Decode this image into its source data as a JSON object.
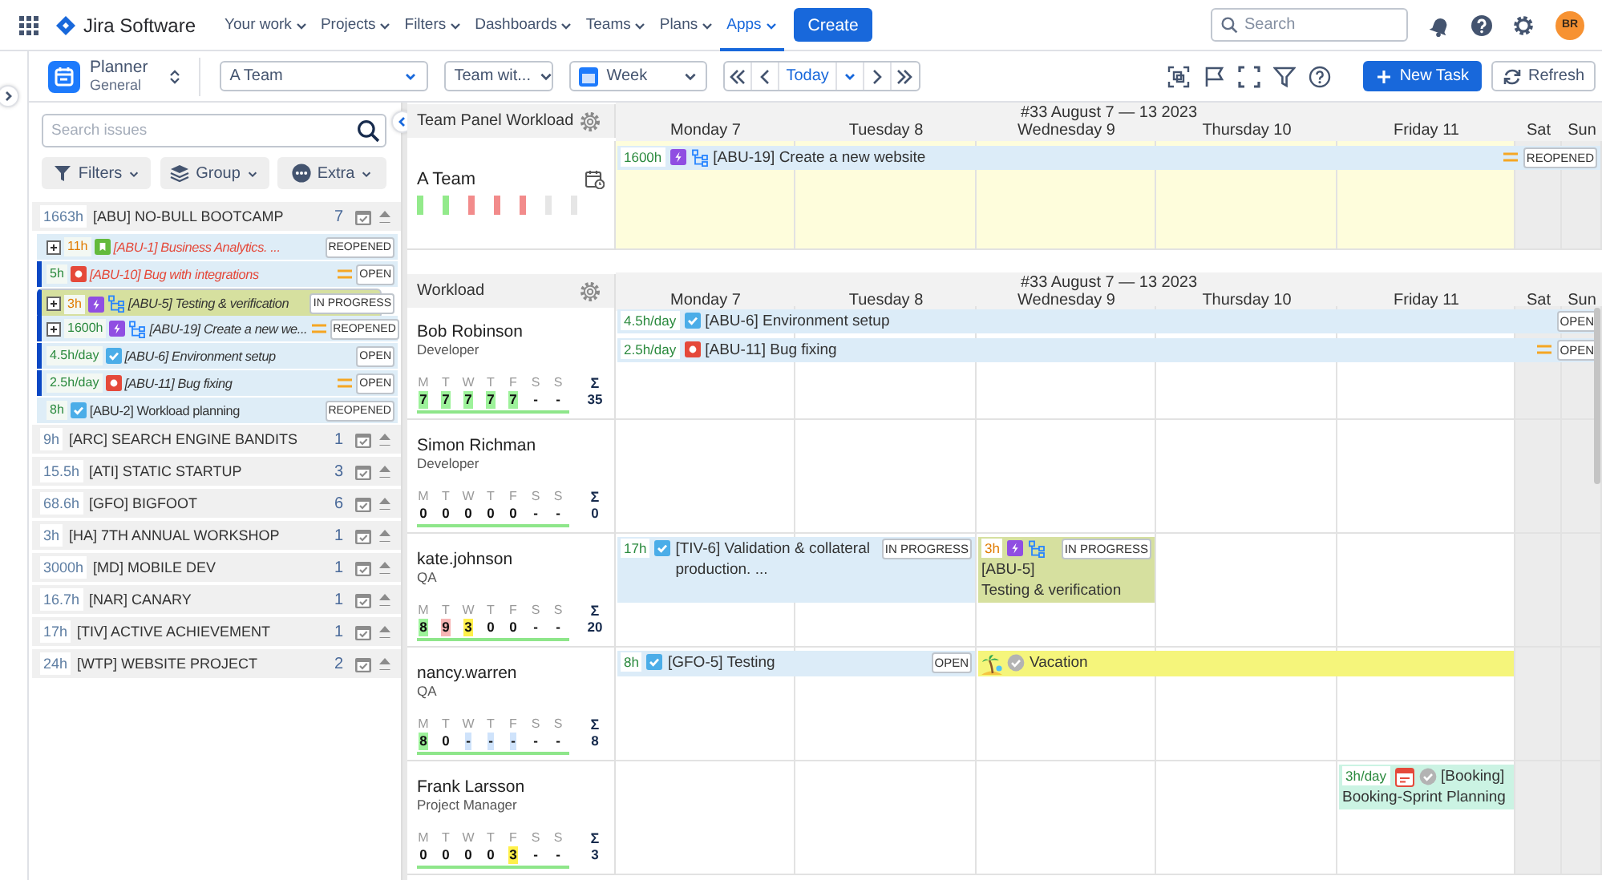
{
  "topnav": {
    "logo": "Jira Software",
    "items": [
      {
        "label": "Your work",
        "selected": false
      },
      {
        "label": "Projects",
        "selected": false
      },
      {
        "label": "Filters",
        "selected": false
      },
      {
        "label": "Dashboards",
        "selected": false
      },
      {
        "label": "Teams",
        "selected": false
      },
      {
        "label": "Plans",
        "selected": false
      },
      {
        "label": "Apps",
        "selected": true
      }
    ],
    "create": "Create",
    "search": {
      "placeholder": "Search"
    },
    "avatar": "BR"
  },
  "toolbar": {
    "app": {
      "title": "Planner",
      "subtitle": "General"
    },
    "selects": [
      {
        "kind": "team",
        "value": "A Team"
      },
      {
        "kind": "view",
        "value": "Team wit..."
      },
      {
        "kind": "period",
        "value": "Week"
      }
    ],
    "today": "Today",
    "new_task": "New Task",
    "refresh": "Refresh"
  },
  "issues_panel": {
    "search": {
      "placeholder": "Search issues"
    },
    "buttons": [
      {
        "kind": "filters",
        "label": "Filters"
      },
      {
        "kind": "group",
        "label": "Group"
      },
      {
        "kind": "extra",
        "label": "Extra"
      }
    ],
    "projects": [
      {
        "hours": "1663h",
        "name": "[ABU] NO-BULL BOOTCAMP",
        "count": "7",
        "issues": [
          {
            "expandable": true,
            "hours": "11h",
            "warning": true,
            "kind": "story",
            "subtasks": false,
            "label": {
              "kind": "overdue",
              "text": "[ABU-1] Business Analytics. ..."
            },
            "prioritized": false,
            "status": "REOPENED",
            "marked": false,
            "selected": false
          },
          {
            "expandable": false,
            "hours": "5h",
            "warning": false,
            "kind": "bug",
            "subtasks": false,
            "label": {
              "kind": "overdue",
              "text": "[ABU-10] Bug with integrations"
            },
            "prioritized": true,
            "status": "OPEN",
            "marked": true,
            "selected": false
          },
          {
            "expandable": true,
            "hours": "3h",
            "warning": true,
            "kind": "epic",
            "subtasks": true,
            "label": {
              "kind": "scheduled",
              "text": "[ABU-5] Testing & verification"
            },
            "prioritized": false,
            "status": "IN PROGRESS",
            "marked": true,
            "selected": true
          },
          {
            "expandable": true,
            "hours": "1600h",
            "warning": false,
            "kind": "epic",
            "subtasks": true,
            "label": {
              "kind": "scheduled",
              "text": "[ABU-19] Create a new we..."
            },
            "prioritized": true,
            "status": "REOPENED",
            "marked": true,
            "selected": false
          },
          {
            "expandable": false,
            "hours": "4.5h/day",
            "warning": false,
            "kind": "task",
            "subtasks": false,
            "label": {
              "kind": "scheduled",
              "text": "[ABU-6] Environment setup"
            },
            "prioritized": false,
            "status": "OPEN",
            "marked": true,
            "selected": false
          },
          {
            "expandable": false,
            "hours": "2.5h/day",
            "warning": false,
            "kind": "bug",
            "subtasks": false,
            "label": {
              "kind": "scheduled",
              "text": "[ABU-11] Bug fixing"
            },
            "prioritized": true,
            "status": "OPEN",
            "marked": true,
            "selected": false
          },
          {
            "expandable": false,
            "hours": "8h",
            "warning": false,
            "kind": "task",
            "subtasks": false,
            "label": {
              "kind": "plain",
              "text": "[ABU-2] Workload planning"
            },
            "prioritized": false,
            "status": "REOPENED",
            "marked": false,
            "selected": false
          }
        ]
      },
      {
        "hours": "9h",
        "name": "[ARC] SEARCH ENGINE BANDITS",
        "count": "1"
      },
      {
        "hours": "15.5h",
        "name": "[ATI] STATIC STARTUP",
        "count": "3"
      },
      {
        "hours": "68.6h",
        "name": "[GFO] BIGFOOT",
        "count": "6"
      },
      {
        "hours": "3h",
        "name": "[HA] 7TH ANNUAL WORKSHOP",
        "count": "1"
      },
      {
        "hours": "3000h",
        "name": "[MD] MOBILE DEV",
        "count": "1"
      },
      {
        "hours": "16.7h",
        "name": "[NAR] CANARY",
        "count": "1"
      },
      {
        "hours": "17h",
        "name": "[TIV] ACTIVE ACHIEVEMENT",
        "count": "1"
      },
      {
        "hours": "24h",
        "name": "[WTP] WEBSITE PROJECT",
        "count": "2"
      }
    ]
  },
  "team_panel": {
    "title": "Team Panel Workload",
    "team": "A Team",
    "day_loads": [
      {
        "color": "#93ea8b"
      },
      {
        "color": "#93ea8b"
      },
      {
        "color": "#f28b8b"
      },
      {
        "color": "#f28b8b"
      },
      {
        "color": "#f28b8b"
      },
      {
        "color": "#e6e6e6"
      },
      {
        "color": "#e6e6e6"
      }
    ],
    "week": "#33 August 7 — 13 2023",
    "days": [
      {
        "label": "Monday 7",
        "weekend": false
      },
      {
        "label": "Tuesday 8",
        "weekend": false
      },
      {
        "label": "Wednesday 9",
        "weekend": false
      },
      {
        "label": "Thursday 10",
        "weekend": false
      },
      {
        "label": "Friday 11",
        "weekend": false
      },
      {
        "label": "Sat",
        "weekend": true
      },
      {
        "label": "Sun",
        "weekend": true
      }
    ],
    "lanes": [
      {
        "slots": [
          {
            "kind": "epic",
            "hours": "1600h",
            "warning": false,
            "subtasks": true,
            "title": "[ABU-19] Create a new website",
            "prioritized": true,
            "status": "REOPENED",
            "color": "#dcecf8"
          },
          {
            "kind": "continued"
          },
          {
            "kind": "continued"
          },
          {
            "kind": "continued"
          },
          {
            "kind": "continued"
          },
          {
            "kind": "continued"
          },
          {
            "kind": "continued"
          }
        ]
      }
    ]
  },
  "workload": {
    "title": "Workload",
    "week": "#33 August 7 — 13 2023",
    "days": [
      {
        "label": "Monday 7",
        "weekend": false
      },
      {
        "label": "Tuesday 8",
        "weekend": false
      },
      {
        "label": "Wednesday 9",
        "weekend": false
      },
      {
        "label": "Thursday 10",
        "weekend": false
      },
      {
        "label": "Friday 11",
        "weekend": false
      },
      {
        "label": "Sat",
        "weekend": true
      },
      {
        "label": "Sun",
        "weekend": true
      }
    ],
    "people": [
      {
        "name": "Bob Robinson",
        "role": "Developer",
        "sum_label": "Σ",
        "total": "35",
        "days": [
          {
            "letter": "M",
            "value": "7",
            "color": "#9df29a"
          },
          {
            "letter": "T",
            "value": "7",
            "color": "#9df29a"
          },
          {
            "letter": "W",
            "value": "7",
            "color": "#9df29a"
          },
          {
            "letter": "T",
            "value": "7",
            "color": "#9df29a"
          },
          {
            "letter": "F",
            "value": "7",
            "color": "#9df29a"
          },
          {
            "letter": "S",
            "value": "-"
          },
          {
            "letter": "S",
            "value": "-"
          }
        ],
        "lanes": [
          {
            "slots": [
              {
                "kind": "task",
                "hours": "4.5h/day",
                "warning": false,
                "subtasks": false,
                "title": "[ABU-6] Environment setup",
                "prioritized": false,
                "status": "OPEN",
                "color": "#dcecf8"
              },
              {
                "kind": "continued"
              },
              {
                "kind": "continued"
              },
              {
                "kind": "continued"
              },
              {
                "kind": "continued"
              },
              {
                "kind": "continued"
              },
              {
                "kind": "continued"
              }
            ]
          },
          {
            "slots": [
              {
                "kind": "bug",
                "hours": "2.5h/day",
                "warning": false,
                "subtasks": false,
                "title": "[ABU-11] Bug fixing",
                "prioritized": true,
                "status": "OPEN",
                "color": "#dcecf8"
              },
              {
                "kind": "continued"
              },
              {
                "kind": "continued"
              },
              {
                "kind": "continued"
              },
              {
                "kind": "continued"
              },
              {
                "kind": "continued"
              },
              {
                "kind": "continued"
              }
            ]
          }
        ]
      },
      {
        "name": "Simon Richman",
        "role": "Developer",
        "sum_label": "Σ",
        "total": "0",
        "days": [
          {
            "letter": "M",
            "value": "0"
          },
          {
            "letter": "T",
            "value": "0"
          },
          {
            "letter": "W",
            "value": "0"
          },
          {
            "letter": "T",
            "value": "0"
          },
          {
            "letter": "F",
            "value": "0"
          },
          {
            "letter": "S",
            "value": "-"
          },
          {
            "letter": "S",
            "value": "-"
          }
        ]
      },
      {
        "name": "kate.johnson",
        "role": "QA",
        "sum_label": "Σ",
        "total": "20",
        "days": [
          {
            "letter": "M",
            "value": "8",
            "color": "#9df29a"
          },
          {
            "letter": "T",
            "value": "9",
            "color": "#f7b5b5"
          },
          {
            "letter": "W",
            "value": "3",
            "color": "#fff04a"
          },
          {
            "letter": "T",
            "value": "0"
          },
          {
            "letter": "F",
            "value": "0"
          },
          {
            "letter": "S",
            "value": "-"
          },
          {
            "letter": "S",
            "value": "-"
          }
        ],
        "lanes": [
          {
            "slots": [
              {
                "kind": "task",
                "hours": "17h",
                "warning": false,
                "subtasks": false,
                "title": "[TIV-6] Validation & collateral production. ...",
                "prioritized": false,
                "status": "IN PROGRESS",
                "color": "#dcecf8"
              },
              {
                "kind": "continued"
              },
              {
                "kind": "epic",
                "hours": "3h",
                "warning": true,
                "subtasks": true,
                "title": "[ABU-5]",
                "subtitle": "Testing & verification",
                "prioritized": false,
                "status": "IN PROGRESS",
                "color": "#d6e09f"
              },
              {
                "kind": "empty"
              },
              {
                "kind": "empty"
              },
              {
                "kind": "empty"
              },
              {
                "kind": "empty"
              }
            ]
          }
        ]
      },
      {
        "name": "nancy.warren",
        "role": "QA",
        "sum_label": "Σ",
        "total": "8",
        "days": [
          {
            "letter": "M",
            "value": "8",
            "color": "#9df29a"
          },
          {
            "letter": "T",
            "value": "0"
          },
          {
            "letter": "W",
            "value": "-",
            "color": "#cfe3fb"
          },
          {
            "letter": "T",
            "value": "-",
            "color": "#cfe3fb"
          },
          {
            "letter": "F",
            "value": "-",
            "color": "#cfe3fb"
          },
          {
            "letter": "S",
            "value": "-"
          },
          {
            "letter": "S",
            "value": "-"
          }
        ],
        "lanes": [
          {
            "slots": [
              {
                "kind": "task",
                "hours": "8h",
                "warning": false,
                "subtasks": false,
                "title": "[GFO-5] Testing",
                "prioritized": false,
                "status": "OPEN",
                "color": "#dcecf8"
              },
              {
                "kind": "continued"
              },
              {
                "kind": "absence",
                "title": "Vacation",
                "color": "#f5f57b"
              },
              {
                "kind": "continued"
              },
              {
                "kind": "continued"
              },
              {
                "kind": "empty"
              },
              {
                "kind": "empty"
              }
            ]
          }
        ]
      },
      {
        "name": "Frank Larsson",
        "role": "Project Manager",
        "sum_label": "Σ",
        "total": "3",
        "days": [
          {
            "letter": "M",
            "value": "0"
          },
          {
            "letter": "T",
            "value": "0"
          },
          {
            "letter": "W",
            "value": "0"
          },
          {
            "letter": "T",
            "value": "0"
          },
          {
            "letter": "F",
            "value": "3",
            "color": "#fff04a"
          },
          {
            "letter": "S",
            "value": "-"
          },
          {
            "letter": "S",
            "value": "-"
          }
        ],
        "lanes": [
          {
            "slots": [
              {
                "kind": "empty"
              },
              {
                "kind": "empty"
              },
              {
                "kind": "empty"
              },
              {
                "kind": "empty"
              },
              {
                "kind": "booking",
                "hours": "3h/day",
                "warning": false,
                "title": "[Booking]",
                "subtitle": "Booking-Sprint Planning",
                "color": "#cbf3e3"
              },
              {
                "kind": "empty"
              },
              {
                "kind": "empty"
              }
            ]
          }
        ]
      }
    ]
  }
}
